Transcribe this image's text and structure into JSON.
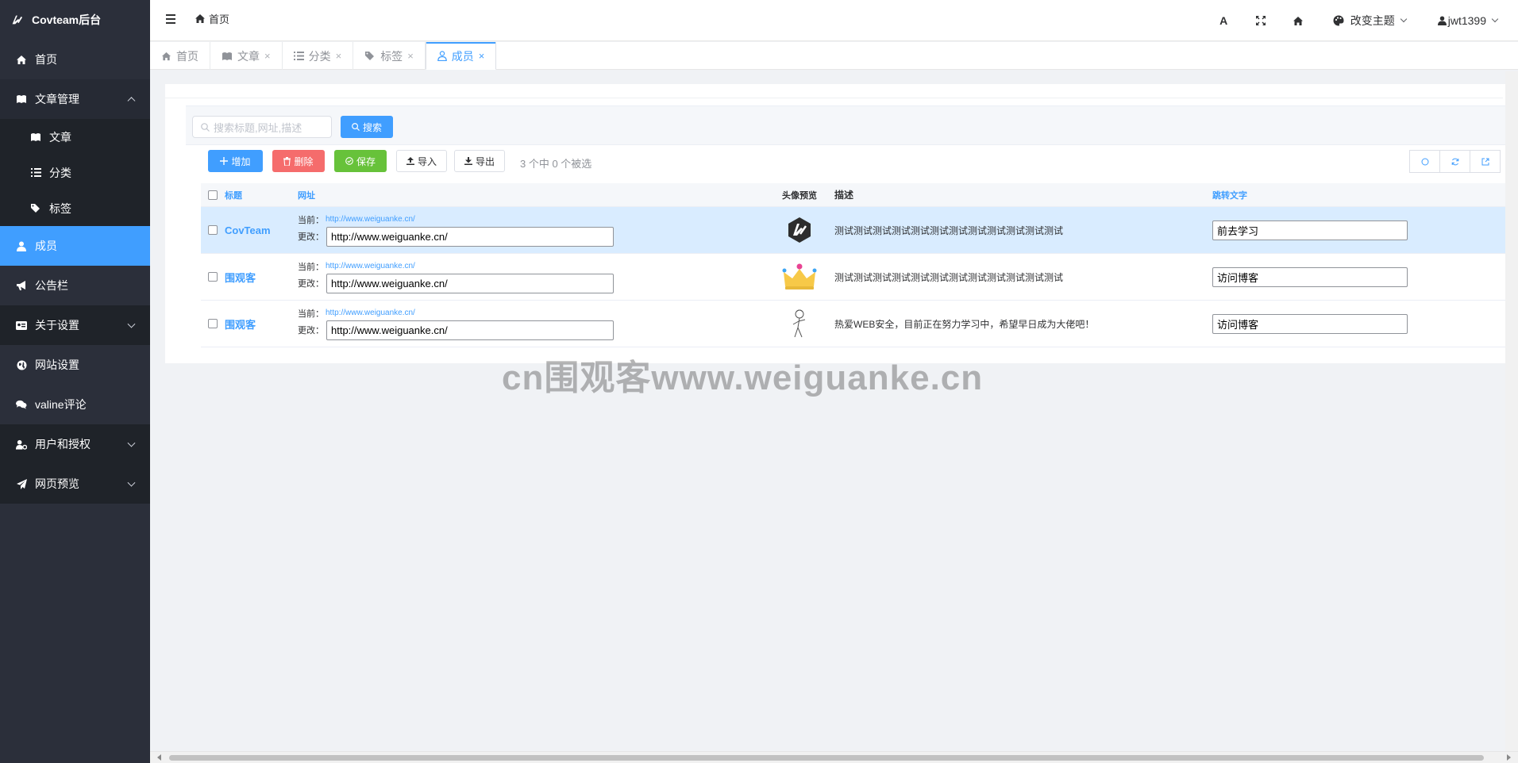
{
  "app": {
    "title": "Covteam后台"
  },
  "sidebar": {
    "items": [
      {
        "label": "首页",
        "icon": "home-icon"
      },
      {
        "label": "文章管理",
        "icon": "book-icon",
        "expanded": true,
        "children": [
          {
            "label": "文章",
            "icon": "book-icon"
          },
          {
            "label": "分类",
            "icon": "list-icon"
          },
          {
            "label": "标签",
            "icon": "tags-icon"
          }
        ]
      },
      {
        "label": "成员",
        "icon": "user-icon",
        "active": true
      },
      {
        "label": "公告栏",
        "icon": "bullhorn-icon"
      },
      {
        "label": "关于设置",
        "icon": "id-card-icon"
      },
      {
        "label": "网站设置",
        "icon": "globe-icon"
      },
      {
        "label": "valine评论",
        "icon": "comments-icon"
      },
      {
        "label": "用户和授权",
        "icon": "user-gear-icon"
      },
      {
        "label": "网页预览",
        "icon": "paper-plane-icon"
      }
    ]
  },
  "header": {
    "breadcrumb": "首页",
    "theme_label": "改变主题",
    "user": "jwt1399",
    "font_icon_label": "A"
  },
  "tabs": [
    {
      "label": "首页",
      "closable": false
    },
    {
      "label": "文章",
      "closable": true
    },
    {
      "label": "分类",
      "closable": true
    },
    {
      "label": "标签",
      "closable": true
    },
    {
      "label": "成员",
      "closable": true,
      "active": true
    }
  ],
  "toolbar": {
    "search_placeholder": "搜索标题,网址,描述",
    "search_label": "搜索",
    "add_label": "增加",
    "delete_label": "删除",
    "save_label": "保存",
    "import_label": "导入",
    "export_label": "导出",
    "selection_info": "3 个中 0 个被选"
  },
  "table": {
    "headers": {
      "title": "标题",
      "url": "网址",
      "avatar": "头像预览",
      "desc": "描述",
      "jump": "跳转文字"
    },
    "current_label": "当前：",
    "change_label": "更改：",
    "rows": [
      {
        "title": "CovTeam",
        "current_url": "http://www.weiguanke.cn/",
        "url_value": "http://www.weiguanke.cn/",
        "avatar": "covteam-logo-icon",
        "desc": "测试测试测试测试测试测试测试测试测试测试测试测试",
        "jump": "前去学习",
        "highlighted": true
      },
      {
        "title": "围观客",
        "current_url": "http://www.weiguanke.cn/",
        "url_value": "http://www.weiguanke.cn/",
        "avatar": "crown-icon",
        "desc": "测试测试测试测试测试测试测试测试测试测试测试测试",
        "jump": "访问博客"
      },
      {
        "title": "围观客",
        "current_url": "http://www.weiguanke.cn/",
        "url_value": "http://www.weiguanke.cn/",
        "avatar": "sketch-figure-icon",
        "desc": "热爱WEB安全，目前正在努力学习中，希望早日成为大佬吧！",
        "jump": "访问博客"
      }
    ]
  },
  "watermark": "cn围观客www.weiguanke.cn",
  "colors": {
    "primary": "#409eff",
    "danger": "#f56c6c",
    "success": "#67c23a",
    "sidebar": "#2b2f3a"
  }
}
